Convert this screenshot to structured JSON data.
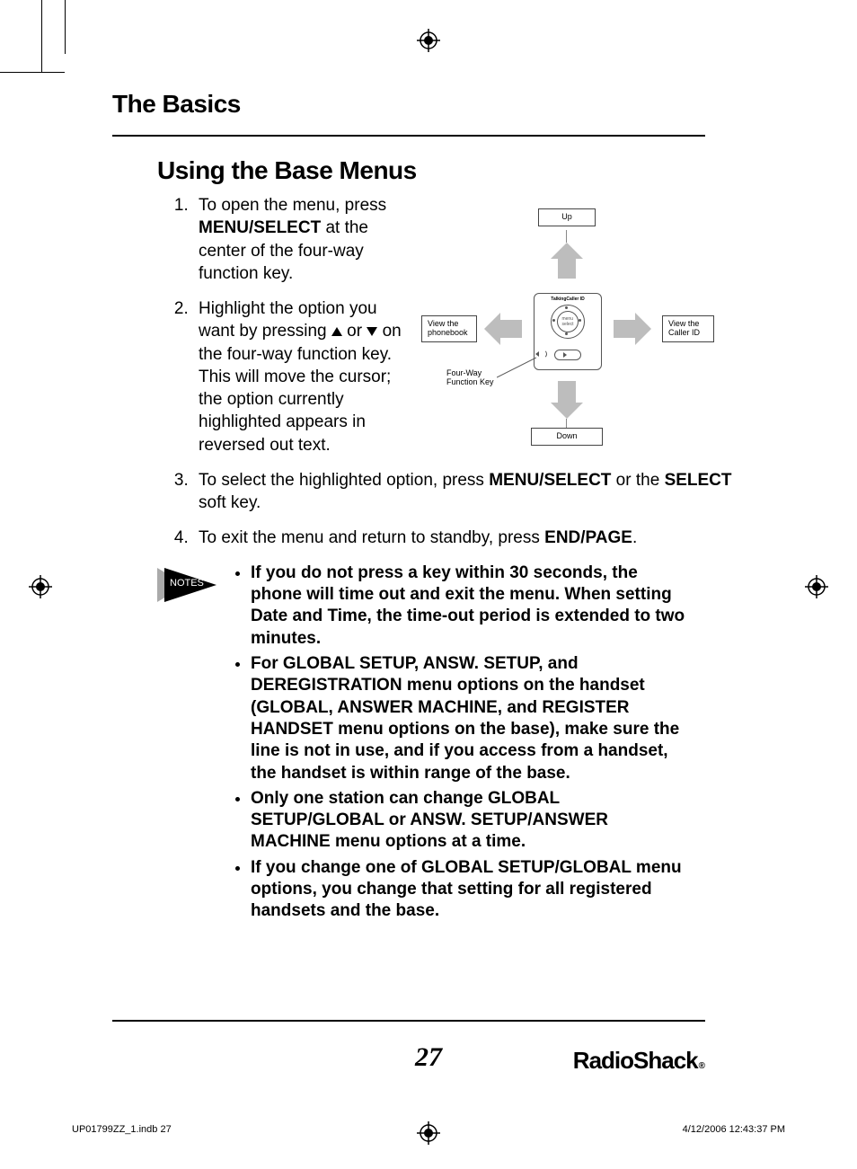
{
  "chapterTitle": "The Basics",
  "sectionTitle": "Using the Base Menus",
  "steps": {
    "s1a": "To open the menu, press ",
    "s1b": "MENU/SELECT",
    "s1c": " at the center of the four-way function key.",
    "s2a": "Highlight the option you want by pressing ",
    "s2b": " or ",
    "s2c": " on the four-way function key. This will move the cursor; the option currently highlighted appears in reversed out text.",
    "s3a": "To select the highlighted option, press ",
    "s3b": "MENU/SELECT",
    "s3c": " or the ",
    "s3d": "SELECT",
    "s3e": " soft key.",
    "s4a": "To exit the menu and return to standby, press ",
    "s4b": "END/PAGE",
    "s4c": "."
  },
  "diagram": {
    "up": "Up",
    "down": "Down",
    "left": "View the phonebook",
    "right": "View the Caller ID",
    "funcKey": "Four-Way Function Key",
    "deviceText": "TalkingCaller ID"
  },
  "notesLabel": "NOTES",
  "notes": {
    "n1": "If you do not press a key within 30 seconds, the phone will time out and exit the menu. When setting Date and Time, the time-out period is extended to two minutes.",
    "n2": "For GLOBAL SETUP, ANSW. SETUP, and DEREGISTRATION menu options on the handset (GLOBAL, ANSWER MACHINE, and REGISTER HANDSET menu options on the base), make sure the line is not in use, and if you access from a handset, the handset is within range of the base.",
    "n3": "Only one station can change GLOBAL SETUP/GLOBAL or ANSW. SETUP/ANSWER MACHINE menu options at a time.",
    "n4": "If you change one of GLOBAL SETUP/GLOBAL menu options, you change that setting for all registered handsets and the base."
  },
  "pageNumber": "27",
  "brand": "RadioShack",
  "slugLeft": "UP01799ZZ_1.indb   27",
  "slugRight": "4/12/2006   12:43:37 PM"
}
